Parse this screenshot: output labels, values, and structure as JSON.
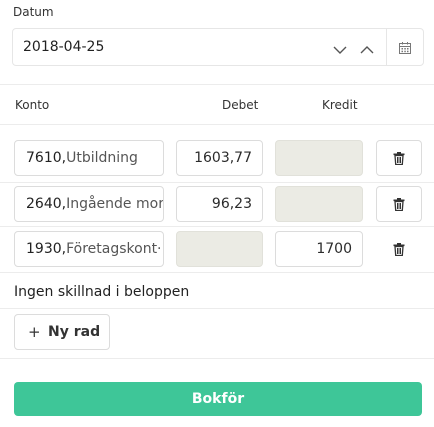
{
  "date": {
    "label": "Datum",
    "value": "2018-04-25"
  },
  "table": {
    "headers": {
      "konto": "Konto",
      "debet": "Debet",
      "kredit": "Kredit"
    },
    "rows": [
      {
        "konto_number": "7610,",
        "konto_name": "Utbildning",
        "debet": "1603,77",
        "kredit": ""
      },
      {
        "konto_number": "2640,",
        "konto_name": "Ingående mor",
        "debet": "96,23",
        "kredit": ""
      },
      {
        "konto_number": "1930,",
        "konto_name": "Företagskont·",
        "debet": "",
        "kredit": "1700"
      }
    ]
  },
  "status_text": "Ingen skillnad i beloppen",
  "add_row": {
    "icon": "plus-icon",
    "label": "Ny rad"
  },
  "submit_label": "Bokför",
  "colors": {
    "accent": "#3ec698",
    "disabled_field": "#ebebe4"
  }
}
